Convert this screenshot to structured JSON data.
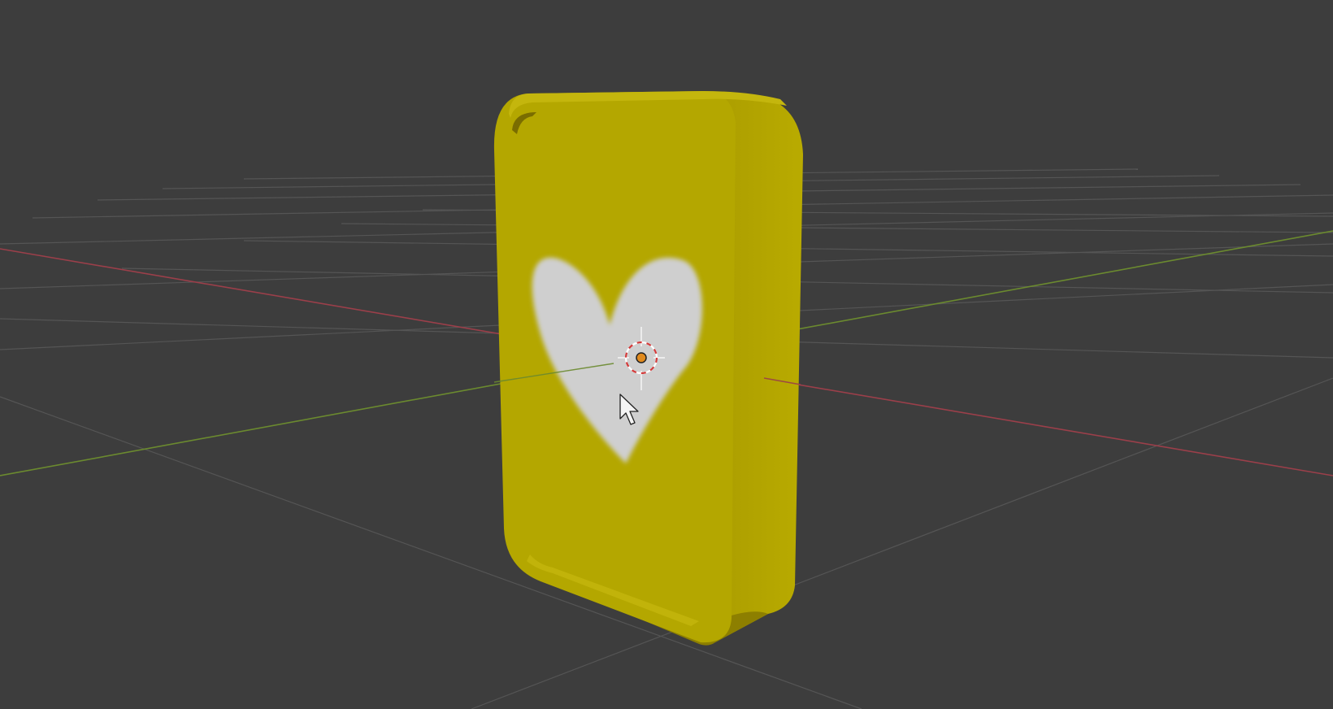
{
  "viewport": {
    "background_color": "#3d3d3d",
    "grid_color": "#555555",
    "x_axis_color": "#9b3f4a",
    "y_axis_color": "#6b8a2f"
  },
  "object": {
    "shape": "rounded-rectangle-slab",
    "body_color": "#b4a700",
    "highlight_color": "#c4b60d",
    "shadow_color": "#8d7f00",
    "decal_icon": "heart-icon",
    "decal_color": "#cfcfcf"
  },
  "gizmo": {
    "icon": "3d-cursor-icon",
    "origin_color": "#e08a1e"
  },
  "cursor": {
    "icon": "mouse-pointer-icon"
  }
}
